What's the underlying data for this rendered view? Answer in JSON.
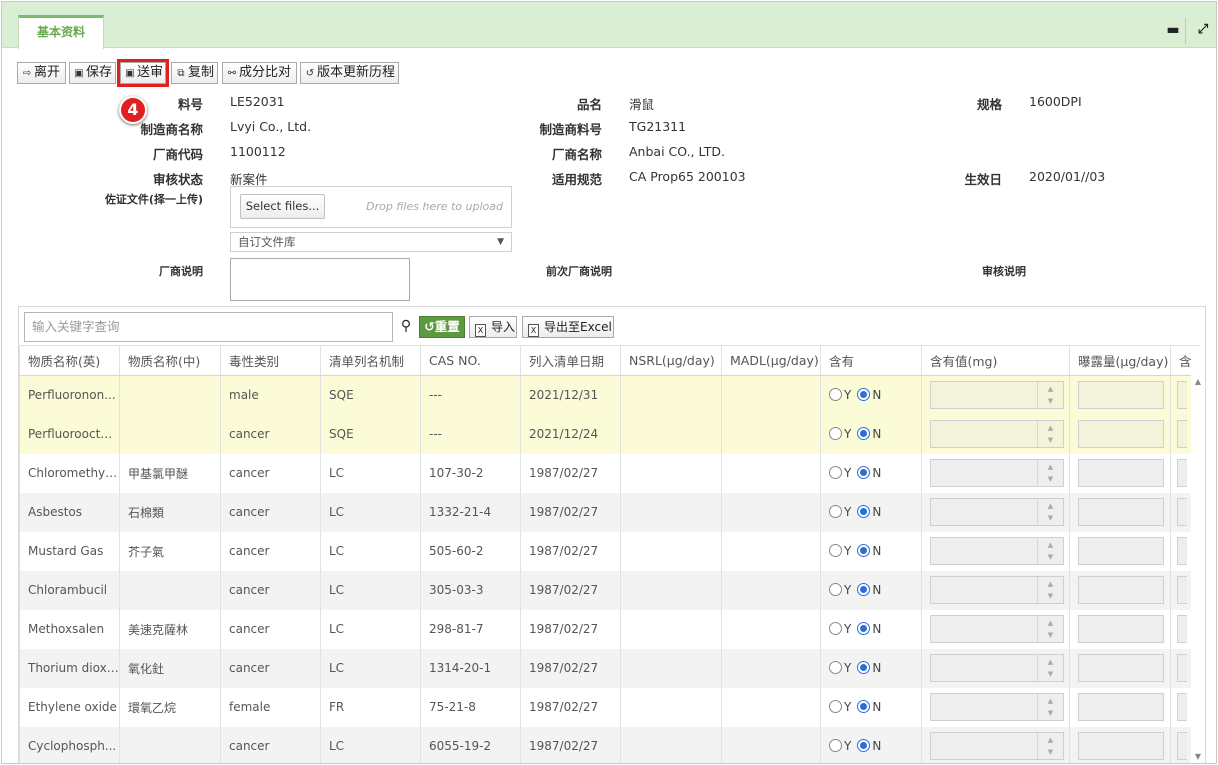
{
  "tab": {
    "label": "基本资料"
  },
  "window_controls": {
    "minimize": "▬",
    "expand": "⤢"
  },
  "toolbar": [
    {
      "name": "leave-button",
      "icon": "exit-icon",
      "glyph": "⇨",
      "label": "离开"
    },
    {
      "name": "save-button",
      "icon": "save-icon",
      "glyph": "▣",
      "label": "保存"
    },
    {
      "name": "submit-review-button",
      "icon": "save-icon",
      "glyph": "▣",
      "label": "送审"
    },
    {
      "name": "copy-button",
      "icon": "copy-icon",
      "glyph": "⧉",
      "label": "复制"
    },
    {
      "name": "compare-button",
      "icon": "link-icon",
      "glyph": "⚯",
      "label": "成分比对"
    },
    {
      "name": "history-button",
      "icon": "history-icon",
      "glyph": "↺",
      "label": "版本更新历程"
    }
  ],
  "step_badge": "4",
  "form": {
    "part_no_label": "料号",
    "part_no": "LE52031",
    "product_name_label": "品名",
    "product_name": "滑鼠",
    "spec_label": "规格",
    "spec": "1600DPI",
    "maker_name_label": "制造商名称",
    "maker_name": "Lvyi Co., Ltd.",
    "maker_part_label": "制造商料号",
    "maker_part": "TG21311",
    "vendor_code_label": "厂商代码",
    "vendor_code": "1100112",
    "vendor_name_label": "厂商名称",
    "vendor_name": "Anbai CO., LTD.",
    "review_status_label": "审核状态",
    "review_status": "新案件",
    "regulation_label": "适用规范",
    "regulation": "CA Prop65 200103",
    "effective_label": "生效日",
    "effective_date": "2020/01//03",
    "evidence_label": "佐证文件(择一上传)",
    "select_files": "Select files...",
    "drop_hint": "Drop files here to upload",
    "library_select": "自订文件库",
    "vendor_note_label": "厂商说明",
    "prev_vendor_note_label": "前次厂商说明",
    "review_note_label": "审核说明"
  },
  "grid": {
    "search_placeholder": "输入关键字查询",
    "reset_label": "重置",
    "import_label": "导入",
    "export_label": "导出至Excel",
    "columns": [
      "物质名称(英)",
      "物质名称(中)",
      "毒性类别",
      "清单列名机制",
      "CAS NO.",
      "列入清单日期",
      "NSRL(μg/day)",
      "MADL(μg/day)",
      "含有",
      "含有值(mg)",
      "曝露量(μg/day)",
      "含"
    ],
    "yes_label": "Y",
    "no_label": "N",
    "rows": [
      {
        "en": "Perfluoronon...",
        "zh": "",
        "tox": "male",
        "mech": "SQE",
        "cas": "---",
        "date": "2021/12/31",
        "nsrl": "",
        "madl": "",
        "contains": "N",
        "style": "hl"
      },
      {
        "en": "Perfluoroocta...",
        "zh": "",
        "tox": "cancer",
        "mech": "SQE",
        "cas": "---",
        "date": "2021/12/24",
        "nsrl": "",
        "madl": "",
        "contains": "N",
        "style": "hl"
      },
      {
        "en": "Chloromethyl ...",
        "zh": "甲基氯甲醚",
        "tox": "cancer",
        "mech": "LC",
        "cas": "107-30-2",
        "date": "1987/02/27",
        "nsrl": "",
        "madl": "",
        "contains": "N",
        "style": "odd"
      },
      {
        "en": "Asbestos",
        "zh": "石棉類",
        "tox": "cancer",
        "mech": "LC",
        "cas": "1332-21-4",
        "date": "1987/02/27",
        "nsrl": "",
        "madl": "",
        "contains": "N",
        "style": "even"
      },
      {
        "en": "Mustard Gas",
        "zh": "芥子氣",
        "tox": "cancer",
        "mech": "LC",
        "cas": "505-60-2",
        "date": "1987/02/27",
        "nsrl": "",
        "madl": "",
        "contains": "N",
        "style": "odd"
      },
      {
        "en": "Chlorambucil",
        "zh": "",
        "tox": "cancer",
        "mech": "LC",
        "cas": "305-03-3",
        "date": "1987/02/27",
        "nsrl": "",
        "madl": "",
        "contains": "N",
        "style": "even"
      },
      {
        "en": "Methoxsalen",
        "zh": "美速克薩林",
        "tox": "cancer",
        "mech": "LC",
        "cas": "298-81-7",
        "date": "1987/02/27",
        "nsrl": "",
        "madl": "",
        "contains": "N",
        "style": "odd"
      },
      {
        "en": "Thorium dioxide",
        "zh": "氧化釷",
        "tox": "cancer",
        "mech": "LC",
        "cas": "1314-20-1",
        "date": "1987/02/27",
        "nsrl": "",
        "madl": "",
        "contains": "N",
        "style": "even"
      },
      {
        "en": "Ethylene oxide",
        "zh": "環氧乙烷",
        "tox": "female",
        "mech": "FR",
        "cas": "75-21-8",
        "date": "1987/02/27",
        "nsrl": "",
        "madl": "",
        "contains": "N",
        "style": "odd"
      },
      {
        "en": "Cyclophosph...",
        "zh": "",
        "tox": "cancer",
        "mech": "LC",
        "cas": "6055-19-2",
        "date": "1987/02/27",
        "nsrl": "",
        "madl": "",
        "contains": "N",
        "style": "even"
      }
    ]
  }
}
